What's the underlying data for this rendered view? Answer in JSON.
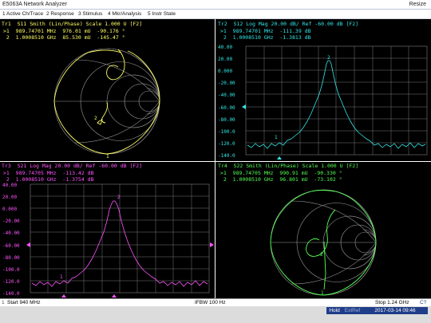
{
  "window": {
    "title": "E5063A Network Analyzer",
    "resize_label": "Resize"
  },
  "menu": {
    "items": [
      "1 Active Ch/Trace",
      "2 Response",
      "3 Stimulus",
      "4 Mkr/Analysis",
      "5 Instr State"
    ]
  },
  "traces": {
    "tr1": {
      "header": "Tr1  S11 Smith (Lin/Phase) Scale 1.000 U [F2]",
      "marker1": ">1  989.74701 MHz  976.01 mU  -90.176 °",
      "marker2": " 2  1.0008510 GHz  85.530 mU  -145.47 °",
      "color": "#ffff66"
    },
    "tr2": {
      "header": "Tr2  S12 Log Mag 20.00 dB/ Ref -60.00 dB [F2]",
      "marker1": ">1  989.74701 MHz  -111.39 dB",
      "marker2": " 2  1.0008510 GHz  -1.3813 dB",
      "color": "#33e6e6",
      "y_ticks": [
        "40.00",
        "20.00",
        "0.000",
        "-20.00",
        "-40.00",
        "-60.00",
        "-80.00",
        "-100.0",
        "-120.0",
        "-140.0"
      ]
    },
    "tr3": {
      "header": "Tr3  S21 Log Mag 20.00 dB/ Ref -60.00 dB [F2]",
      "marker1": ">1  989.74705 MHz  -113.42 dB",
      "marker2": " 2  1.0008510 GHz  -1.3754 dB",
      "color": "#ff55ff",
      "y_ticks": [
        "40.00",
        "20.00",
        "0.000",
        "-20.00",
        "-40.00",
        "-60.00",
        "-80.00",
        "-100.0",
        "-120.0",
        "-140.0"
      ]
    },
    "tr4": {
      "header": "Tr4  S22 Smith (Lin/Phase) Scale 1.000 U [F2]",
      "marker1": ">1  989.74705 MHz  990.91 mU  -90.330 °",
      "marker2": " 2  1.0008510 GHz  96.801 mU  -73.102 °",
      "color": "#55ff55"
    }
  },
  "status": {
    "channel": "1",
    "start": "Start 940 MHz",
    "ifbw": "IFBW 100 Hz",
    "stop": "Stop 1.24 GHz",
    "sweep_indicator": "C?"
  },
  "bottom": {
    "hold": "Hold",
    "extref": "ExtRef",
    "datetime": "2017-03-14 09:46"
  },
  "colors": {
    "background": "#000000",
    "grid": "#9a9a9a",
    "tr1": "#ffff66",
    "tr2": "#33e6e6",
    "tr3": "#ff55ff",
    "tr4": "#55ff55",
    "status_blue": "#1f3d88"
  }
}
